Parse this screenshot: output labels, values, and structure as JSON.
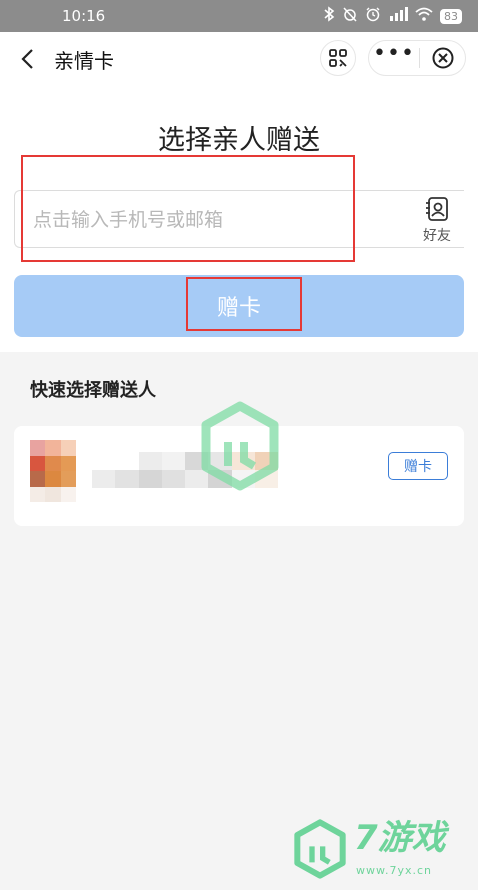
{
  "status_bar": {
    "time": "10:16",
    "battery": "83"
  },
  "nav": {
    "title": "亲情卡"
  },
  "page": {
    "title": "选择亲人赠送"
  },
  "input": {
    "placeholder": "点击输入手机号或邮箱",
    "friend_label": "好友"
  },
  "give_button": {
    "label": "赠卡"
  },
  "quick_select": {
    "title": "快速选择赠送人",
    "contact": {
      "give_label": "赠卡"
    }
  },
  "watermark": {
    "brand": "7游戏",
    "url": "www.7yx.cn"
  },
  "colors": {
    "status_bar": "#8c8c8c",
    "primary_button_disabled": "#a6cbf6",
    "accent_blue": "#3b7dd8",
    "highlight_red": "#e53935",
    "watermark_green": "#6ed49b"
  },
  "icons": [
    "bluetooth-icon",
    "alarm-off-icon",
    "alarm-icon",
    "signal-icon",
    "wifi-icon",
    "battery-icon",
    "back-arrow-icon",
    "qr-scan-icon",
    "more-icon",
    "close-circle-icon",
    "contacts-book-icon",
    "watermark-logo-icon"
  ]
}
